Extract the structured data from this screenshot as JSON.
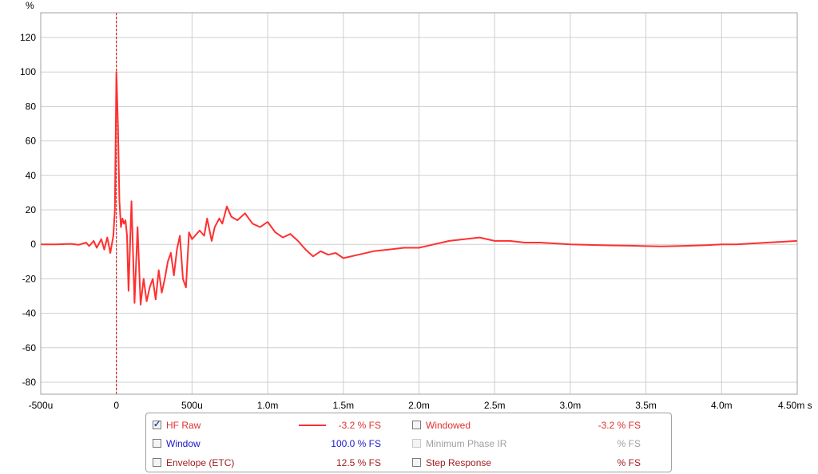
{
  "chart_data": {
    "type": "line",
    "ylabel": "%",
    "xlabel": "",
    "x_unit": "s",
    "xlim": [
      -0.0005,
      0.0045
    ],
    "ylim": [
      -90,
      130
    ],
    "y_ticks": [
      120,
      100,
      80,
      60,
      40,
      20,
      0,
      -20,
      -40,
      -60,
      -80
    ],
    "x_ticks": [
      {
        "v": -0.0005,
        "label": "-500u"
      },
      {
        "v": 0,
        "label": "0"
      },
      {
        "v": 0.0005,
        "label": "500u"
      },
      {
        "v": 0.001,
        "label": "1.0m"
      },
      {
        "v": 0.0015,
        "label": "1.5m"
      },
      {
        "v": 0.002,
        "label": "2.0m"
      },
      {
        "v": 0.0025,
        "label": "2.5m"
      },
      {
        "v": 0.003,
        "label": "3.0m"
      },
      {
        "v": 0.0035,
        "label": "3.5m"
      },
      {
        "v": 0.004,
        "label": "4.0m"
      },
      {
        "v": 0.0045,
        "label": "4.50m s"
      }
    ],
    "grid": true,
    "marker_x": 0,
    "series": [
      {
        "name": "HF Raw",
        "color": "#ff3030",
        "points": [
          [
            -0.0005,
            0
          ],
          [
            -0.0004,
            0
          ],
          [
            -0.0003,
            0.3
          ],
          [
            -0.00025,
            -0.3
          ],
          [
            -0.0002,
            1
          ],
          [
            -0.00018,
            -1
          ],
          [
            -0.00015,
            2
          ],
          [
            -0.00013,
            -2
          ],
          [
            -0.0001,
            3
          ],
          [
            -8e-05,
            -3
          ],
          [
            -6e-05,
            4
          ],
          [
            -4e-05,
            -5
          ],
          [
            -2e-05,
            5
          ],
          [
            -1e-05,
            20
          ],
          [
            0,
            100
          ],
          [
            1e-05,
            70
          ],
          [
            2e-05,
            25
          ],
          [
            3e-05,
            10
          ],
          [
            4e-05,
            15
          ],
          [
            5e-05,
            12
          ],
          [
            6e-05,
            14
          ],
          [
            7e-05,
            5
          ],
          [
            8e-05,
            -27
          ],
          [
            0.0001,
            25
          ],
          [
            0.00012,
            -34
          ],
          [
            0.00014,
            10
          ],
          [
            0.00016,
            -35
          ],
          [
            0.00018,
            -20
          ],
          [
            0.0002,
            -33
          ],
          [
            0.00022,
            -25
          ],
          [
            0.00024,
            -20
          ],
          [
            0.00026,
            -32
          ],
          [
            0.00028,
            -15
          ],
          [
            0.0003,
            -28
          ],
          [
            0.00032,
            -20
          ],
          [
            0.00034,
            -10
          ],
          [
            0.00036,
            -5
          ],
          [
            0.00038,
            -18
          ],
          [
            0.0004,
            -3
          ],
          [
            0.00042,
            5
          ],
          [
            0.00044,
            -20
          ],
          [
            0.00046,
            -25
          ],
          [
            0.00048,
            7
          ],
          [
            0.0005,
            3
          ],
          [
            0.00052,
            5
          ],
          [
            0.00055,
            8
          ],
          [
            0.00058,
            5
          ],
          [
            0.0006,
            15
          ],
          [
            0.00063,
            2
          ],
          [
            0.00065,
            10
          ],
          [
            0.00068,
            15
          ],
          [
            0.0007,
            12
          ],
          [
            0.00073,
            22
          ],
          [
            0.00076,
            16
          ],
          [
            0.0008,
            14
          ],
          [
            0.00085,
            18
          ],
          [
            0.0009,
            12
          ],
          [
            0.00095,
            10
          ],
          [
            0.001,
            13
          ],
          [
            0.00105,
            7
          ],
          [
            0.0011,
            4
          ],
          [
            0.00115,
            6
          ],
          [
            0.0012,
            2
          ],
          [
            0.00125,
            -3
          ],
          [
            0.0013,
            -7
          ],
          [
            0.00135,
            -4
          ],
          [
            0.0014,
            -6
          ],
          [
            0.00145,
            -5
          ],
          [
            0.0015,
            -8
          ],
          [
            0.0016,
            -6
          ],
          [
            0.0017,
            -4
          ],
          [
            0.0018,
            -3
          ],
          [
            0.0019,
            -2
          ],
          [
            0.002,
            -2
          ],
          [
            0.0021,
            0
          ],
          [
            0.0022,
            2
          ],
          [
            0.0023,
            3
          ],
          [
            0.0024,
            4
          ],
          [
            0.0025,
            2
          ],
          [
            0.0026,
            2
          ],
          [
            0.0027,
            1
          ],
          [
            0.0028,
            1
          ],
          [
            0.003,
            0
          ],
          [
            0.0032,
            -0.5
          ],
          [
            0.0034,
            -0.8
          ],
          [
            0.0035,
            -1
          ],
          [
            0.0036,
            -1.2
          ],
          [
            0.0037,
            -1
          ],
          [
            0.0038,
            -0.8
          ],
          [
            0.0039,
            -0.5
          ],
          [
            0.004,
            0
          ],
          [
            0.0041,
            0
          ],
          [
            0.0042,
            0.5
          ],
          [
            0.0043,
            1
          ],
          [
            0.0044,
            1.5
          ],
          [
            0.0045,
            2
          ]
        ]
      }
    ]
  },
  "legend": {
    "col1": [
      {
        "label": "HF Raw",
        "value": "-3.2 % FS",
        "checked": true,
        "color": "#e03030",
        "value_color": "#e03030",
        "swatch": "#ff3030",
        "disabled": false
      },
      {
        "label": "Window",
        "value": "100.0 % FS",
        "checked": false,
        "color": "#1a1acc",
        "value_color": "#1a1acc",
        "swatch": "",
        "disabled": false
      },
      {
        "label": "Envelope (ETC)",
        "value": "12.5 % FS",
        "checked": false,
        "color": "#a02020",
        "value_color": "#a02020",
        "swatch": "",
        "disabled": false
      }
    ],
    "col2": [
      {
        "label": "Windowed",
        "value": "-3.2 % FS",
        "checked": false,
        "color": "#e03030",
        "value_color": "#e03030",
        "disabled": false
      },
      {
        "label": "Minimum Phase IR",
        "value": "% FS",
        "checked": false,
        "color": "#a0a0a0",
        "value_color": "#a0a0a0",
        "disabled": true
      },
      {
        "label": "Step Response",
        "value": "% FS",
        "checked": false,
        "color": "#a02020",
        "value_color": "#a02020",
        "disabled": false
      }
    ]
  }
}
